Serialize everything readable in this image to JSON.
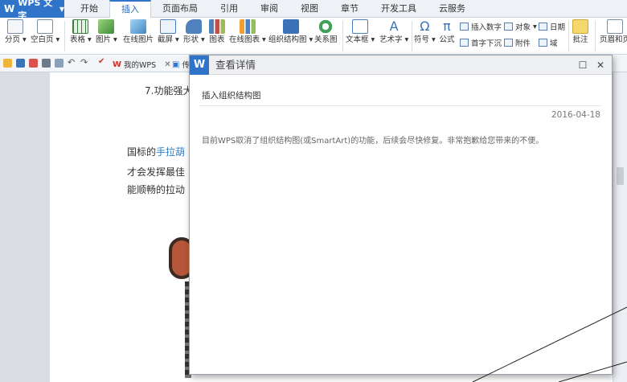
{
  "app": {
    "name": "WPS 文字",
    "logo": "W"
  },
  "menu_tabs": [
    "开始",
    "插入",
    "页面布局",
    "引用",
    "审阅",
    "视图",
    "章节",
    "开发工具",
    "云服务"
  ],
  "active_tab_index": 1,
  "ribbon": {
    "page_break": "分页",
    "blank_page": "空白页",
    "table": "表格",
    "picture": "图片",
    "online_picture": "在线图片",
    "screenshot": "截屏",
    "shape": "形状",
    "chart": "图表",
    "online_chart": "在线图表",
    "org_chart": "组织结构图",
    "relation": "关系图",
    "textbox": "文本框",
    "wordart": "艺术字",
    "symbol": "符号",
    "formula": "公式",
    "insert_number": "插入数字",
    "drop_cap": "首字下沉",
    "object": "对象",
    "attachment": "附件",
    "date": "日期",
    "field": "域",
    "comment": "批注",
    "header_footer": "页眉和页"
  },
  "doc_tabs": [
    {
      "label": "我的WPS"
    },
    {
      "label": "传"
    }
  ],
  "document": {
    "line1": "7.功能强大",
    "line2_prefix": "国标的",
    "line2_link": "手拉葫",
    "line3": "才会发挥最佳",
    "line4": "能顺畅的拉动"
  },
  "dialog": {
    "title": "查看详情",
    "subject": "插入组织结构图",
    "date": "2016-04-18",
    "message": "目前WPS取消了组织结构图(或SmartArt)的功能，后续会尽快修复。非常抱歉给您带来的不便。",
    "maximize_glyph": "☐",
    "close_glyph": "✕"
  },
  "colors": {
    "accent": "#2f74c8",
    "link": "#2c7bc9"
  }
}
